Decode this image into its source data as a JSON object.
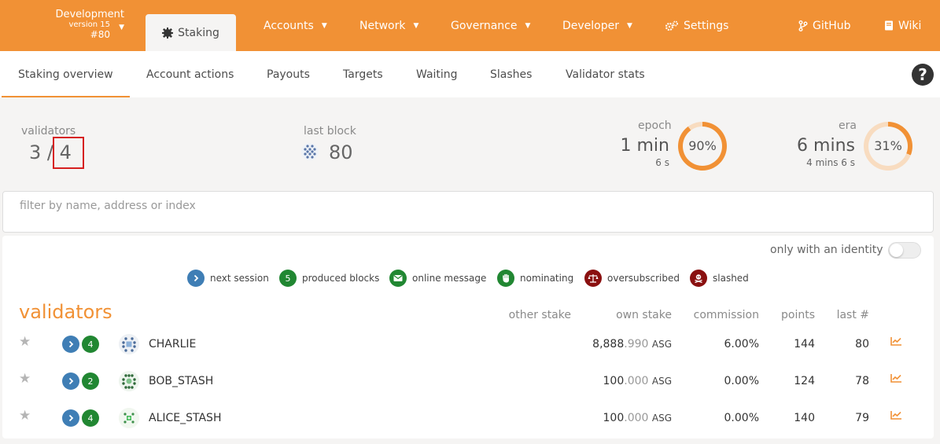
{
  "header": {
    "chain_name": "Development",
    "chain_version": "version 15",
    "chain_block": "#80",
    "active_tab": "Staking",
    "nav": [
      "Accounts",
      "Network",
      "Governance",
      "Developer",
      "Settings",
      "GitHub",
      "Wiki"
    ]
  },
  "subnav": {
    "tabs": [
      "Staking overview",
      "Account actions",
      "Payouts",
      "Targets",
      "Waiting",
      "Slashes",
      "Validator stats"
    ],
    "help": "?"
  },
  "summary": {
    "validators_label": "validators",
    "validators_active": "3",
    "validators_sep": "/",
    "validators_total": "4",
    "last_block_label": "last block",
    "last_block_value": "80",
    "epoch_label": "epoch",
    "epoch_value": "1 min",
    "epoch_sub": "6 s",
    "epoch_percent": 90,
    "epoch_percent_text": "90%",
    "era_label": "era",
    "era_value": "6 mins",
    "era_sub": "4 mins 6 s",
    "era_percent": 31,
    "era_percent_text": "31%"
  },
  "filter": {
    "placeholder": "filter by name, address or index",
    "value": ""
  },
  "identity_toggle": {
    "label": "only with an identity",
    "on": false
  },
  "legend": [
    {
      "badge": "",
      "label": "next session"
    },
    {
      "badge": "5",
      "label": "produced blocks"
    },
    {
      "badge": "",
      "label": "online message"
    },
    {
      "badge": "",
      "label": "nominating"
    },
    {
      "badge": "",
      "label": "oversubscribed"
    },
    {
      "badge": "",
      "label": "slashed"
    }
  ],
  "table": {
    "title": "validators",
    "columns": [
      "other stake",
      "own stake",
      "commission",
      "points",
      "last #"
    ],
    "rows": [
      {
        "name": "CHARLIE",
        "blocks": "4",
        "own_int": "8,888",
        "own_dec": ".990",
        "unit": "ASG",
        "commission": "6.00%",
        "points": "144",
        "last": "80"
      },
      {
        "name": "BOB_STASH",
        "blocks": "2",
        "own_int": "100",
        "own_dec": ".000",
        "unit": "ASG",
        "commission": "0.00%",
        "points": "124",
        "last": "78"
      },
      {
        "name": "ALICE_STASH",
        "blocks": "4",
        "own_int": "100",
        "own_dec": ".000",
        "unit": "ASG",
        "commission": "0.00%",
        "points": "140",
        "last": "79"
      }
    ]
  },
  "colors": {
    "accent": "#f19135",
    "badge_blue": "#3f7eb5",
    "badge_green": "#218732",
    "badge_dark_red": "#8a1010",
    "highlight_box": "#d61f1f"
  }
}
